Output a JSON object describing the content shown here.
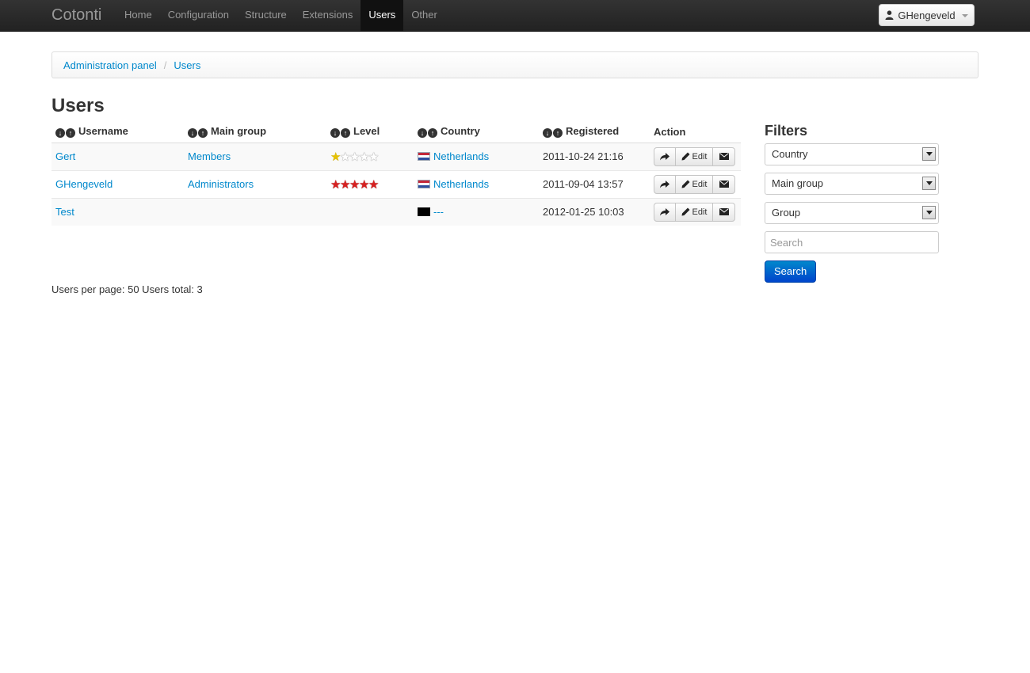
{
  "navbar": {
    "brand": "Cotonti",
    "items": [
      {
        "label": "Home",
        "active": false
      },
      {
        "label": "Configuration",
        "active": false
      },
      {
        "label": "Structure",
        "active": false
      },
      {
        "label": "Extensions",
        "active": false
      },
      {
        "label": "Users",
        "active": true
      },
      {
        "label": "Other",
        "active": false
      }
    ],
    "user_button": "GHengeveld"
  },
  "breadcrumb": [
    {
      "label": "Administration panel"
    },
    {
      "label": "Users"
    }
  ],
  "page_title": "Users",
  "table": {
    "columns": [
      "Username",
      "Main group",
      "Level",
      "Country",
      "Registered",
      "Action"
    ],
    "rows": [
      {
        "username": "Gert",
        "main_group": "Members",
        "level": 1,
        "level_color": "gold",
        "country": "Netherlands",
        "flag": "nl",
        "registered": "2011-10-24 21:16"
      },
      {
        "username": "GHengeveld",
        "main_group": "Administrators",
        "level": 5,
        "level_color": "red",
        "country": "Netherlands",
        "flag": "nl",
        "registered": "2011-09-04 13:57"
      },
      {
        "username": "Test",
        "main_group": "",
        "level": 0,
        "level_color": "none",
        "country": "---",
        "flag": "none",
        "registered": "2012-01-25 10:03"
      }
    ],
    "action_edit_label": "Edit"
  },
  "footer": {
    "text": "Users per page: 50 Users total: 3"
  },
  "filters": {
    "title": "Filters",
    "country": "Country",
    "main_group": "Main group",
    "group": "Group",
    "search_placeholder": "Search",
    "search_button": "Search"
  },
  "colors": {
    "navbar_bg": "#222222",
    "link": "#0088cc",
    "primary_button": "#0066cc"
  }
}
